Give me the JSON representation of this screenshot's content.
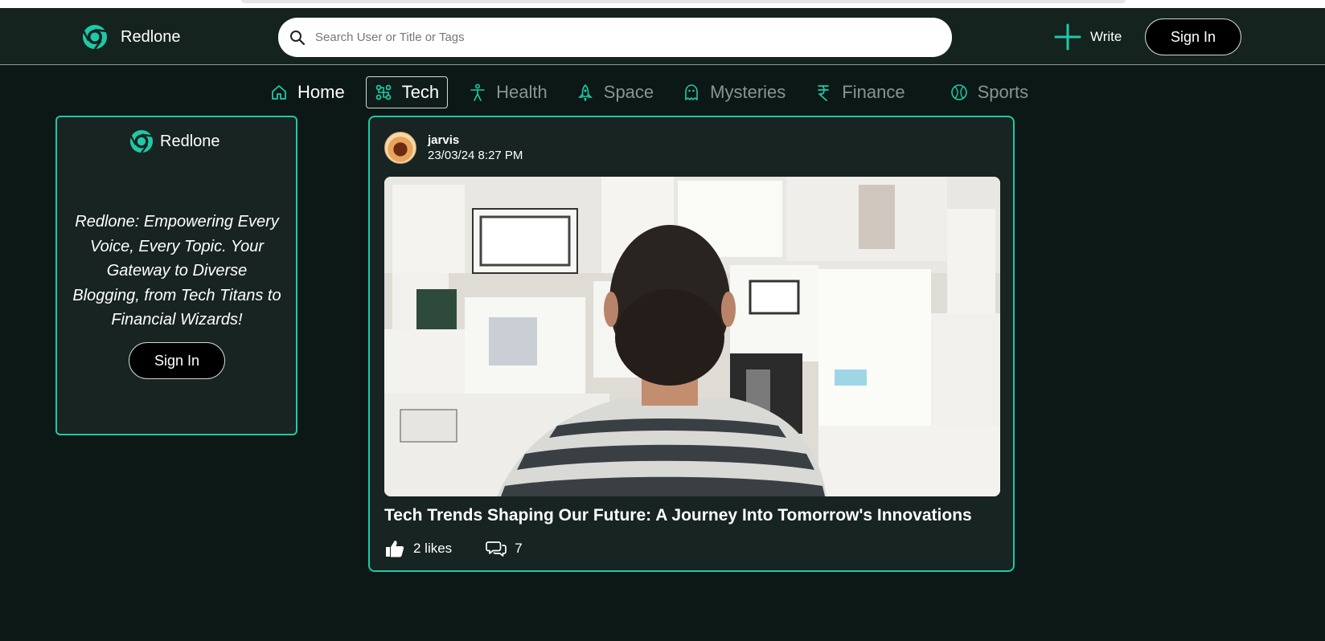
{
  "app": {
    "name": "Redlone"
  },
  "header": {
    "search_placeholder": "Search User or Title or Tags",
    "write_label": "Write",
    "signin_label": "Sign In"
  },
  "nav": {
    "items": [
      {
        "label": "Home",
        "icon": "home-icon"
      },
      {
        "label": "Tech",
        "icon": "tech-icon",
        "active": true
      },
      {
        "label": "Health",
        "icon": "person-icon"
      },
      {
        "label": "Space",
        "icon": "rocket-icon"
      },
      {
        "label": "Mysteries",
        "icon": "ghost-icon"
      },
      {
        "label": "Finance",
        "icon": "rupee-icon"
      },
      {
        "label": "Sports",
        "icon": "ball-icon"
      }
    ]
  },
  "sidebar": {
    "brand": "Redlone",
    "tagline": "Redlone: Empowering Every Voice, Every Topic. Your Gateway to Diverse Blogging, from Tech Titans to Financial Wizards!",
    "signin_label": "Sign In"
  },
  "post": {
    "author": "jarvis",
    "date": "23/03/24 8:27 PM",
    "title": "Tech Trends Shaping Our Future: A Journey Into Tomorrow's Innovations",
    "likes": "2 likes",
    "comments": "7"
  },
  "colors": {
    "accent": "#1fc9a8",
    "background": "#0b1815",
    "card": "#172421"
  }
}
